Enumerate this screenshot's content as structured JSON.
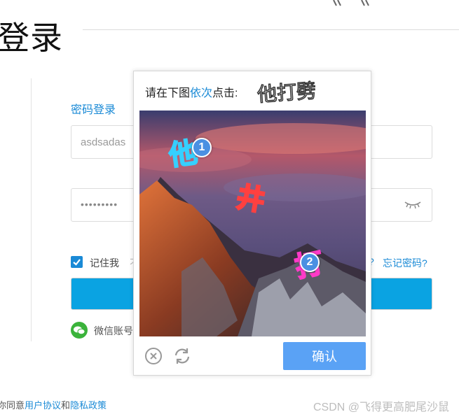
{
  "page": {
    "title": "登录"
  },
  "login": {
    "tab_password": "密码登录",
    "username_value": "asdsadas",
    "password_value": "•••••••••",
    "remember_label": "记住我",
    "hidden_link": "不",
    "question_mark": "?",
    "forgot_password": "忘记密码?",
    "wechat_label": "微信账号"
  },
  "agreement": {
    "prefix": "你同意",
    "terms": "用户协议",
    "and": "和",
    "privacy": "隐私政策"
  },
  "watermark": "CSDN @飞得更高肥尾沙鼠",
  "captcha": {
    "prompt_before": "请在下图",
    "prompt_highlight": "依次",
    "prompt_after": "点击:",
    "target_chars": "他打劈",
    "marker_1": "1",
    "marker_2": "2",
    "image_chars": [
      "他",
      "井",
      "打"
    ],
    "confirm_label": "确认"
  },
  "colors": {
    "accent": "#1a8ad6",
    "login_button": "#0aa3e2",
    "confirm_button": "#5aa2f5",
    "marker": "#4a90e2",
    "wechat": "#3bb33b"
  },
  "icons": {
    "eye": "eye-closed-icon",
    "check": "check-icon",
    "wechat": "wechat-icon",
    "close": "close-icon",
    "refresh": "refresh-icon"
  }
}
